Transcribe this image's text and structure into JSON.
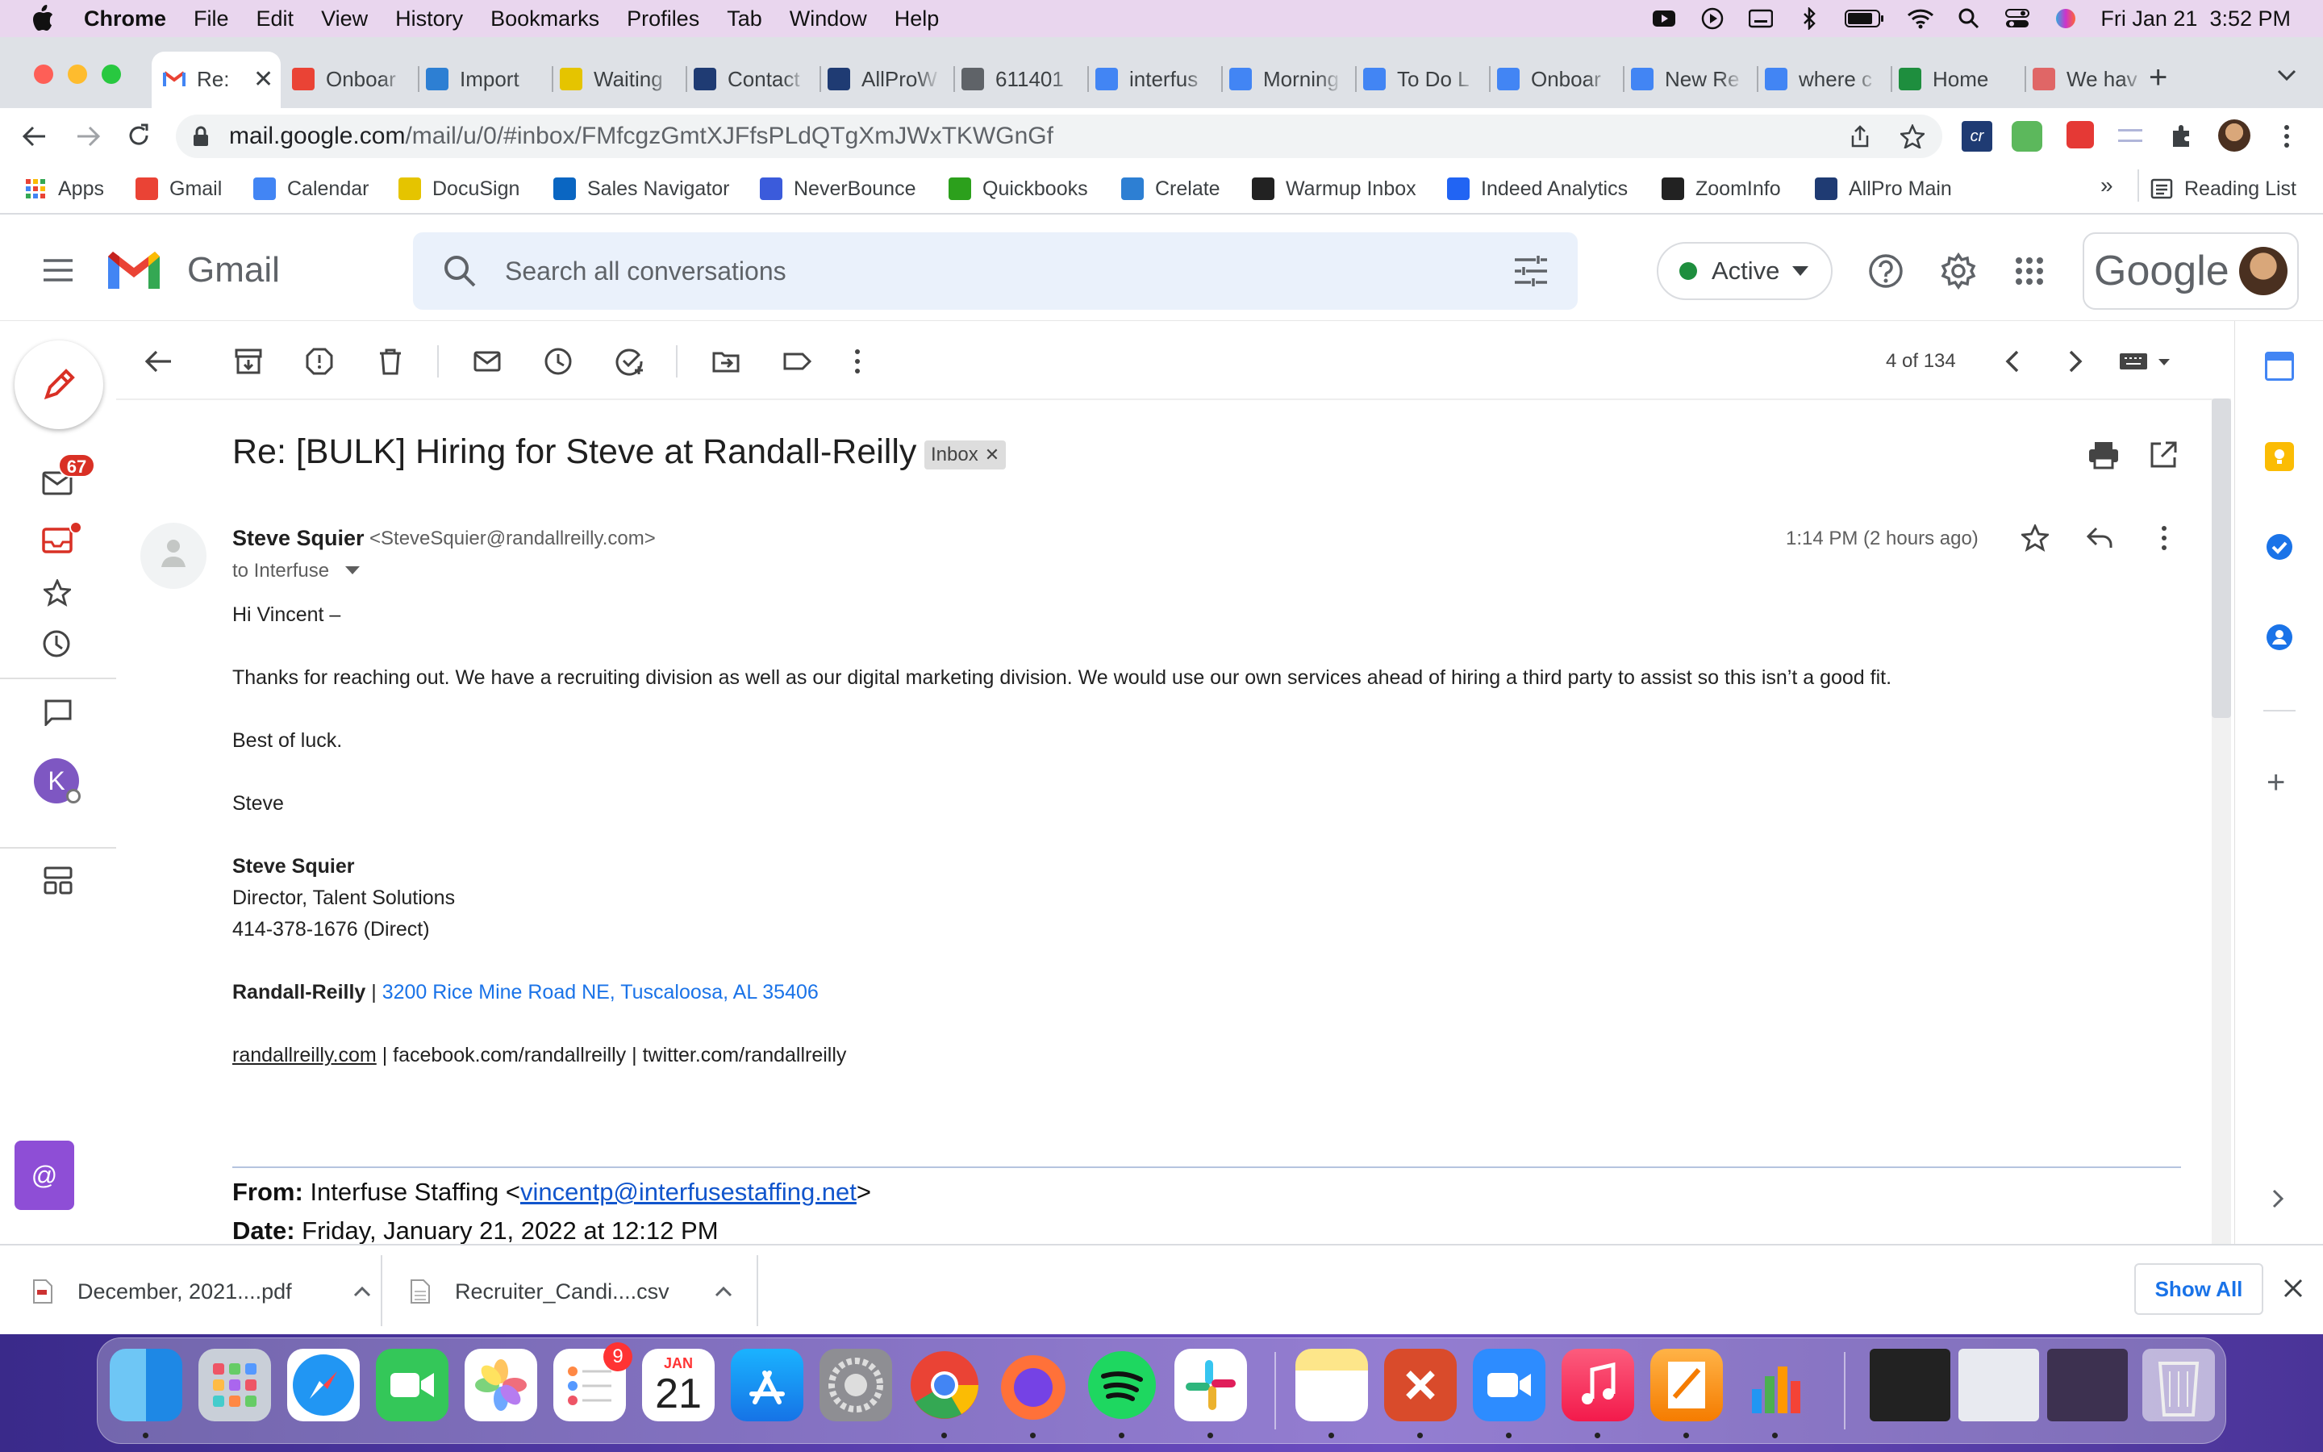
{
  "menubar": {
    "app": "Chrome",
    "items": [
      "File",
      "Edit",
      "View",
      "History",
      "Bookmarks",
      "Profiles",
      "Tab",
      "Window",
      "Help"
    ],
    "clock": "Fri Jan 21  3:52 PM"
  },
  "tabs": [
    {
      "label": "Re:",
      "icon": "gmail-icon",
      "color": "#ea4335"
    },
    {
      "label": "Onboar",
      "icon": "gmail-icon",
      "color": "#ea4335"
    },
    {
      "label": "Import",
      "icon": "crelate-icon",
      "color": "#2d7fd3"
    },
    {
      "label": "Waiting",
      "icon": "docusign-icon",
      "color": "#e5c400"
    },
    {
      "label": "Contact",
      "icon": "allpro-icon",
      "color": "#1f3b73"
    },
    {
      "label": "AllProW",
      "icon": "allpro-icon",
      "color": "#1f3b73"
    },
    {
      "label": "611401",
      "icon": "globe-icon",
      "color": "#5f6368"
    },
    {
      "label": "interfus",
      "icon": "calendar-icon",
      "color": "#4285f4"
    },
    {
      "label": "Morning",
      "icon": "docs-icon",
      "color": "#4285f4"
    },
    {
      "label": "To Do L",
      "icon": "docs-icon",
      "color": "#4285f4"
    },
    {
      "label": "Onboar",
      "icon": "docs-icon",
      "color": "#4285f4"
    },
    {
      "label": "New Re",
      "icon": "docs-icon",
      "color": "#4285f4"
    },
    {
      "label": "where c",
      "icon": "google-icon",
      "color": "#4285f4"
    },
    {
      "label": "Home",
      "icon": "home-icon",
      "color": "#1e8e3e"
    },
    {
      "label": "We hav",
      "icon": "person-icon",
      "color": "#e06666"
    }
  ],
  "address": {
    "domain": "mail.google.com",
    "path": "/mail/u/0/#inbox/FMfcgzGmtXJFfsPLdQTgXmJWxTKWGnGf"
  },
  "bookmarks": [
    {
      "label": "Apps",
      "color": "#ea4335"
    },
    {
      "label": "Gmail",
      "color": "#ea4335"
    },
    {
      "label": "Calendar",
      "color": "#4285f4"
    },
    {
      "label": "DocuSign",
      "color": "#e5c400"
    },
    {
      "label": "Sales Navigator",
      "color": "#0a66c2"
    },
    {
      "label": "NeverBounce",
      "color": "#3b5bdb"
    },
    {
      "label": "Quickbooks",
      "color": "#2ca01c"
    },
    {
      "label": "Crelate",
      "color": "#2d7fd3"
    },
    {
      "label": "Warmup Inbox",
      "color": "#222222"
    },
    {
      "label": "Indeed Analytics",
      "color": "#2164f3"
    },
    {
      "label": "ZoomInfo",
      "color": "#222222"
    },
    {
      "label": "AllPro Main",
      "color": "#1f3b73"
    }
  ],
  "bookmarks_more": "»",
  "reading_list": "Reading List",
  "gmail": {
    "logo_text": "Gmail",
    "search_placeholder": "Search all conversations",
    "status": "Active",
    "google_text": "Google",
    "unread_badge": "67",
    "avatar_letter": "K",
    "pager": "4 of 134"
  },
  "message": {
    "subject": "Re: [BULK] Hiring for Steve at Randall-Reilly",
    "label_chip": "Inbox",
    "sender_name": "Steve Squier",
    "sender_email": "<SteveSquier@randallreilly.com>",
    "to": "to Interfuse",
    "time": "1:14 PM (2 hours ago)",
    "greeting": "Hi Vincent –",
    "para1": "Thanks for reaching out.  We have a recruiting division as well as our digital marketing division.  We would use our own services ahead of hiring a third party to assist so this isn’t a good fit.",
    "closing": "Best of luck.",
    "signoff": "Steve",
    "sig_name": "Steve Squier",
    "sig_title": "Director, Talent Solutions",
    "sig_phone": "414-378-1676 (Direct)",
    "sig_company": "Randall-Reilly",
    "sig_sep": " | ",
    "sig_address": "3200 Rice Mine Road NE, Tuscaloosa, AL 35406",
    "sig_site": "randallreilly.com",
    "sig_social": " | facebook.com/randallreilly | twitter.com/randallreilly",
    "quoted_from_label": "From:",
    "quoted_from_name": " Interfuse Staffing <",
    "quoted_from_email": "vincentp@interfusestaffing.net",
    "quoted_from_end": ">",
    "quoted_date_label": "Date:",
    "quoted_date": " Friday, January 21, 2022 at 12:12 PM"
  },
  "downloads": [
    {
      "name": "December, 2021....pdf"
    },
    {
      "name": "Recruiter_Candi....csv"
    }
  ],
  "show_all": "Show All",
  "dock": {
    "reminders_badge": "9",
    "calendar_month": "JAN",
    "calendar_day": "21"
  }
}
